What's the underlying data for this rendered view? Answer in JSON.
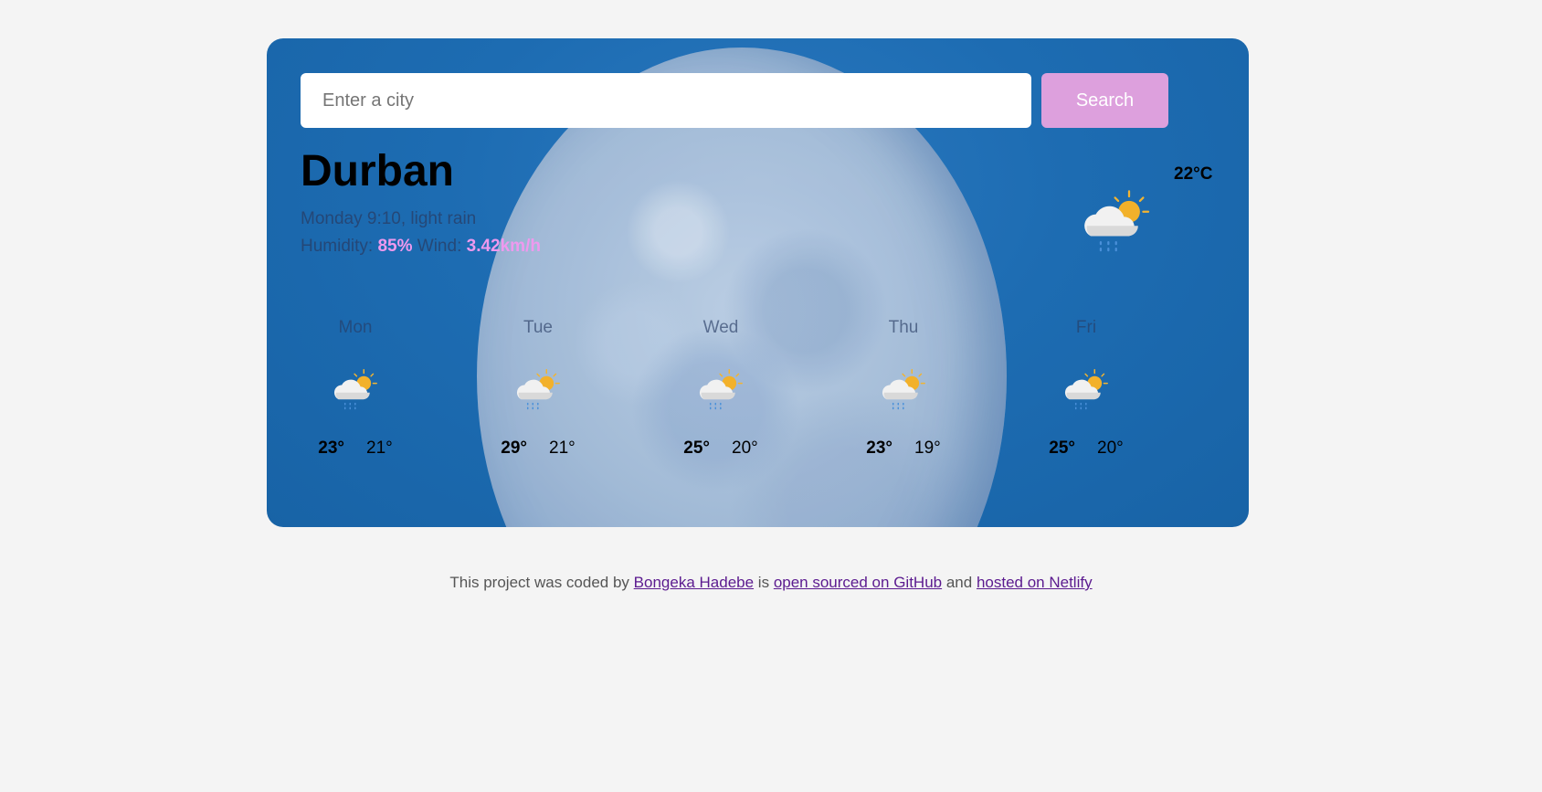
{
  "search": {
    "placeholder": "Enter a city",
    "button_label": "Search"
  },
  "current": {
    "city": "Durban",
    "datetime_desc": "Monday 9:10, light rain",
    "humidity_label": "Humidity:",
    "humidity_value": "85%",
    "wind_label": "Wind:",
    "wind_value": "3.42km/h",
    "temperature": "22°C",
    "icon": "rain-cloud-sun-icon"
  },
  "forecast": [
    {
      "day": "Mon",
      "max": "23°",
      "min": "21°",
      "icon": "rain-cloud-sun-icon"
    },
    {
      "day": "Tue",
      "max": "29°",
      "min": "21°",
      "icon": "rain-cloud-sun-icon"
    },
    {
      "day": "Wed",
      "max": "25°",
      "min": "20°",
      "icon": "rain-cloud-sun-icon"
    },
    {
      "day": "Thu",
      "max": "23°",
      "min": "19°",
      "icon": "rain-cloud-sun-icon"
    },
    {
      "day": "Fri",
      "max": "25°",
      "min": "20°",
      "icon": "rain-cloud-sun-icon"
    }
  ],
  "footer": {
    "text1": "This project was coded by",
    "author_link": "Bongeka Hadebe",
    "text2": "is",
    "github_link": "open sourced on GitHub",
    "text3": "and",
    "netlify_link": "hosted on Netlify"
  },
  "colors": {
    "accent": "#dda0dd",
    "highlight": "#ee99ee",
    "card_bg": "#1d6cb2",
    "link": "#5b1a8f"
  }
}
